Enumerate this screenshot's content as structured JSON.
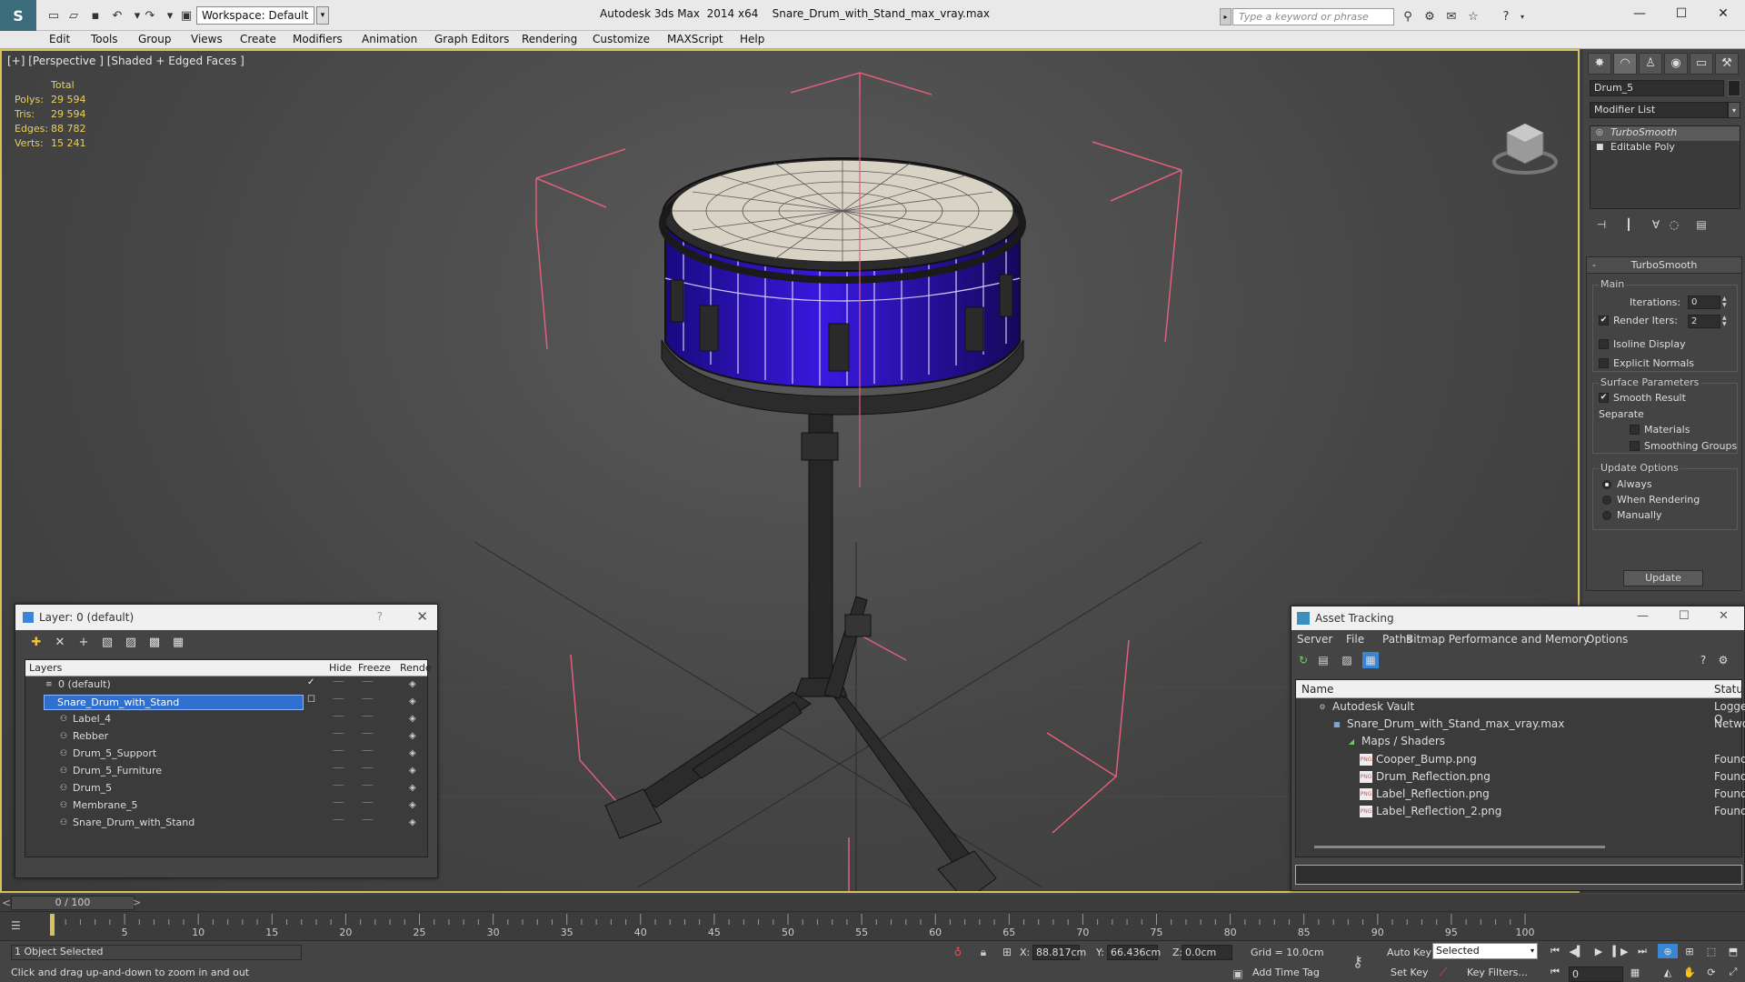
{
  "title_bar": {
    "workspace_label": "Workspace: Default",
    "app_title": "Autodesk 3ds Max  2014 x64",
    "file_title": "Snare_Drum_with_Stand_max_vray.max",
    "search_placeholder": "Type a keyword or phrase"
  },
  "menu": [
    "Edit",
    "Tools",
    "Group",
    "Views",
    "Create",
    "Modifiers",
    "Animation",
    "Graph Editors",
    "Rendering",
    "Customize",
    "MAXScript",
    "Help"
  ],
  "viewport": {
    "label": "[+] [Perspective ] [Shaded + Edged Faces ]",
    "stats": {
      "header": "Total",
      "rows": [
        {
          "label": "Polys:",
          "value": "29 594"
        },
        {
          "label": "Tris:",
          "value": "29 594"
        },
        {
          "label": "Edges:",
          "value": "88 782"
        },
        {
          "label": "Verts:",
          "value": "15 241"
        }
      ]
    }
  },
  "command_panel": {
    "object_name": "Drum_5",
    "modifier_list": "Modifier List",
    "stack": [
      {
        "label": "TurboSmooth",
        "selected": true
      },
      {
        "label": "Editable Poly",
        "selected": false
      }
    ],
    "rollout": {
      "title": "TurboSmooth",
      "main_group": "Main",
      "iterations_label": "Iterations:",
      "iterations_value": "0",
      "render_iters_label": "Render Iters:",
      "render_iters_value": "2",
      "isoline_label": "Isoline Display",
      "explicit_label": "Explicit Normals",
      "surface_group": "Surface Parameters",
      "smooth_label": "Smooth Result",
      "separate_label": "Separate",
      "materials_label": "Materials",
      "smoothing_groups_label": "Smoothing Groups",
      "update_group": "Update Options",
      "always_label": "Always",
      "when_rendering_label": "When Rendering",
      "manually_label": "Manually",
      "update_button": "Update"
    }
  },
  "layer_window": {
    "title": "Layer: 0 (default)",
    "help": "?",
    "columns": {
      "layers": "Layers",
      "hide": "Hide",
      "freeze": "Freeze",
      "render": "Rende"
    },
    "rows": [
      {
        "name": "0 (default)",
        "level": 0,
        "selected": false,
        "active": true
      },
      {
        "name": "Snare_Drum_with_Stand",
        "level": 0,
        "selected": true,
        "active": false
      },
      {
        "name": "Label_4",
        "level": 1,
        "selected": false,
        "active": false
      },
      {
        "name": "Rebber",
        "level": 1,
        "selected": false,
        "active": false
      },
      {
        "name": "Drum_5_Support",
        "level": 1,
        "selected": false,
        "active": false
      },
      {
        "name": "Drum_5_Furniture",
        "level": 1,
        "selected": false,
        "active": false
      },
      {
        "name": "Drum_5",
        "level": 1,
        "selected": false,
        "active": false
      },
      {
        "name": "Membrane_5",
        "level": 1,
        "selected": false,
        "active": false
      },
      {
        "name": "Snare_Drum_with_Stand",
        "level": 1,
        "selected": false,
        "active": false
      }
    ]
  },
  "asset_window": {
    "title": "Asset Tracking",
    "menu": [
      "Server",
      "File",
      "Paths",
      "Bitmap Performance and Memory",
      "Options"
    ],
    "columns": {
      "name": "Name",
      "status": "Status"
    },
    "rows": [
      {
        "name": "Autodesk Vault",
        "status": "Logged O",
        "level": 0,
        "icon": "vault"
      },
      {
        "name": "Snare_Drum_with_Stand_max_vray.max",
        "status": "Network",
        "level": 1,
        "icon": "max"
      },
      {
        "name": "Maps / Shaders",
        "status": "",
        "level": 2,
        "icon": "maps"
      },
      {
        "name": "Cooper_Bump.png",
        "status": "Found",
        "level": 3,
        "icon": "png"
      },
      {
        "name": "Drum_Reflection.png",
        "status": "Found",
        "level": 3,
        "icon": "png"
      },
      {
        "name": "Label_Reflection.png",
        "status": "Found",
        "level": 3,
        "icon": "png"
      },
      {
        "name": "Label_Reflection_2.png",
        "status": "Found",
        "level": 3,
        "icon": "png"
      }
    ]
  },
  "time_slider": {
    "left_arrow": "<",
    "position": "0 / 100",
    "right_arrow": ">"
  },
  "track_ticks": [
    "5",
    "10",
    "15",
    "20",
    "25",
    "30",
    "35",
    "40",
    "45",
    "50",
    "55",
    "60",
    "65",
    "70",
    "75",
    "80",
    "85",
    "90",
    "95",
    "100"
  ],
  "status": {
    "selection": "1 Object Selected",
    "prompt": "Click and drag up-and-down to zoom in and out",
    "x_label": "X:",
    "x_value": "88.817cm",
    "y_label": "Y:",
    "y_value": "66.436cm",
    "z_label": "Z:",
    "z_value": "0.0cm",
    "grid": "Grid = 10.0cm",
    "add_time_tag": "Add Time Tag",
    "auto_key": "Auto Key",
    "selected_combo": "Selected",
    "set_key": "Set Key",
    "key_filters": "Key Filters...",
    "frame_value": "0"
  },
  "colors": {
    "accent_yellow": "#d6c25a",
    "selection_blue": "#2f6fcf",
    "stats_yellow": "#e8d060",
    "drum_shell": "#2a10b8",
    "bbox_pink": "#e0607a"
  }
}
